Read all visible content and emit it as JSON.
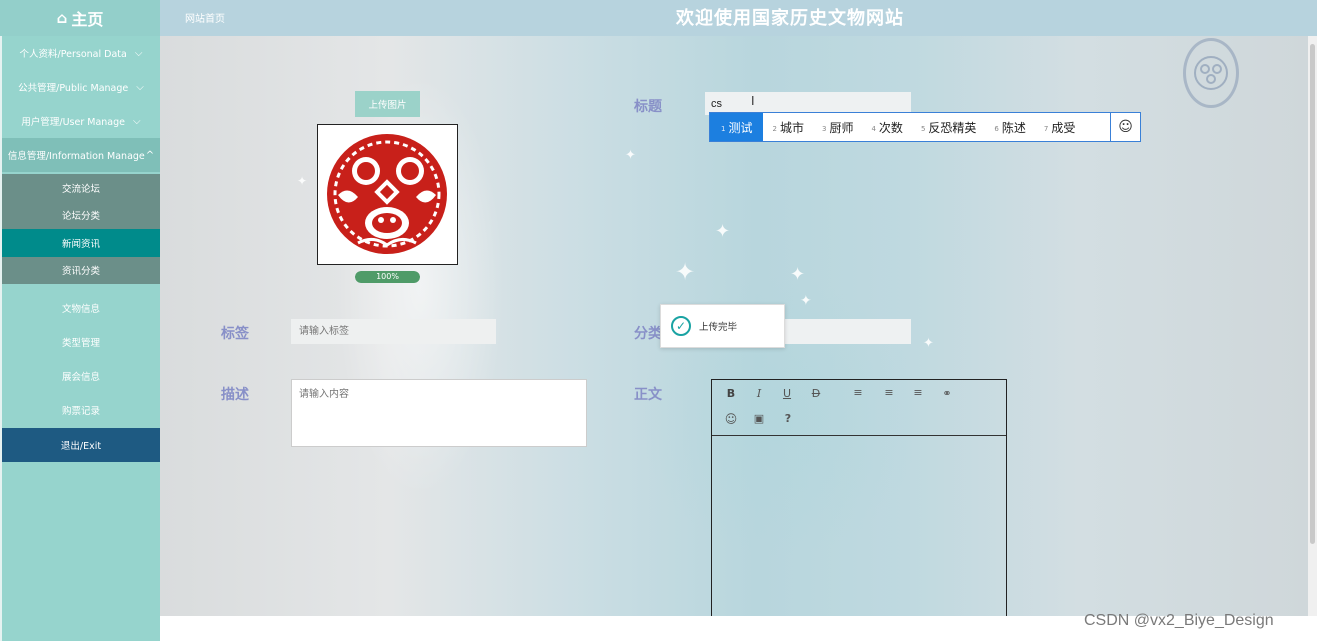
{
  "header": {
    "home_label": "主页",
    "home_icon": "house-icon",
    "breadcrumb": "网站首页",
    "site_title": "欢迎使用国家历史文物网站"
  },
  "sidebar": {
    "groups": [
      {
        "label": "个人资料/Personal Data",
        "icon": "chevron-down-icon"
      },
      {
        "label": "公共管理/Public Manage",
        "icon": "chevron-down-icon"
      },
      {
        "label": "用户管理/User Manage",
        "icon": "chevron-down-icon"
      },
      {
        "label": "信息管理/Information Manage",
        "icon": "chevron-up-icon"
      }
    ],
    "sub_items": [
      "交流论坛",
      "论坛分类",
      "新闻资讯",
      "资讯分类"
    ],
    "active_sub": "新闻资讯",
    "items": [
      "文物信息",
      "类型管理",
      "展会信息",
      "购票记录"
    ],
    "exit_label": "退出/Exit"
  },
  "form": {
    "upload_button": "上传图片",
    "upload_progress_label": "100%",
    "upload_progress": 1.0,
    "title_label": "标题",
    "title_value": "cs",
    "tag_label": "标签",
    "tag_placeholder": "请输入标签",
    "category_label": "分类",
    "desc_label": "描述",
    "desc_placeholder": "请输入内容",
    "body_label": "正文"
  },
  "ime": {
    "candidates": [
      {
        "num": "1",
        "text": "测试"
      },
      {
        "num": "2",
        "text": "城市"
      },
      {
        "num": "3",
        "text": "厨师"
      },
      {
        "num": "4",
        "text": "次数"
      },
      {
        "num": "5",
        "text": "反恐精英"
      },
      {
        "num": "6",
        "text": "陈述"
      },
      {
        "num": "7",
        "text": "成受"
      }
    ],
    "emoji_icon": "smiley-icon"
  },
  "toast": {
    "message": "上传完毕",
    "icon": "check-circle-icon"
  },
  "editor_toolbar": [
    "bold-icon",
    "italic-icon",
    "underline-icon",
    "strikethrough-icon",
    "align-left-icon",
    "align-center-icon",
    "align-right-icon",
    "link-icon",
    "emoji-icon",
    "image-icon",
    "help-icon"
  ],
  "toolbar_glyphs": {
    "bold": "B",
    "italic": "I",
    "underline": "U",
    "strike": "D",
    "help": "?"
  },
  "watermark": "CSDN @vx2_Biye_Design",
  "colors": {
    "sidebar_bg": "#96d4cd",
    "active_sub": "#008b8b",
    "exit_bg": "#1e5a82",
    "label_color": "#8890c8",
    "ime_highlight": "#1c7fe0"
  }
}
